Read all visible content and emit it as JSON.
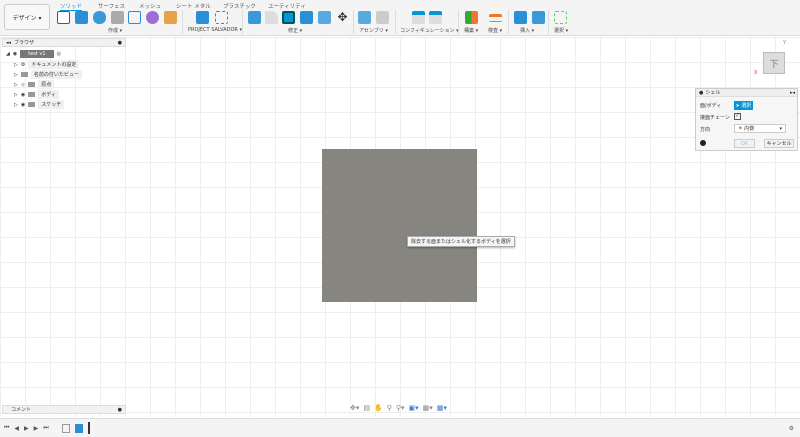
{
  "toolbar": {
    "workspace": "デザイン ▾",
    "tabs": [
      "ソリッド",
      "サーフェス",
      "メッシュ",
      "シート メタル",
      "プラスチック",
      "ユーティリティ"
    ],
    "groups": [
      "作成 ▾",
      "PROJECT SALVADOR ▾",
      "修正 ▾",
      "アセンブリ ▾",
      "コンフィギュレーション ▾",
      "構築 ▾",
      "検査 ▾",
      "挿入 ▾",
      "選択 ▾"
    ]
  },
  "browser": {
    "title": "ブラウザ",
    "root": "test v1",
    "items": [
      "ドキュメントの設定",
      "名前の付いたビュー",
      "原点",
      "ボディ",
      "スケッチ"
    ]
  },
  "viewport": {
    "tooltip": "除去する面またはシェル化するボディを選択",
    "viewcube_face": "下",
    "axis_x": "X",
    "axis_y": "Y",
    "body_color": "#878580"
  },
  "shell": {
    "title": "シェル",
    "face_body_label": "面/ボディ",
    "select_label": "選択",
    "tangent_label": "接面チェーン",
    "tangent_checked": true,
    "direction_label": "方向",
    "direction_value": "内側",
    "ok": "OK",
    "cancel": "キャンセル"
  },
  "comment": {
    "label": "コメント"
  },
  "accent": "#0696d7"
}
